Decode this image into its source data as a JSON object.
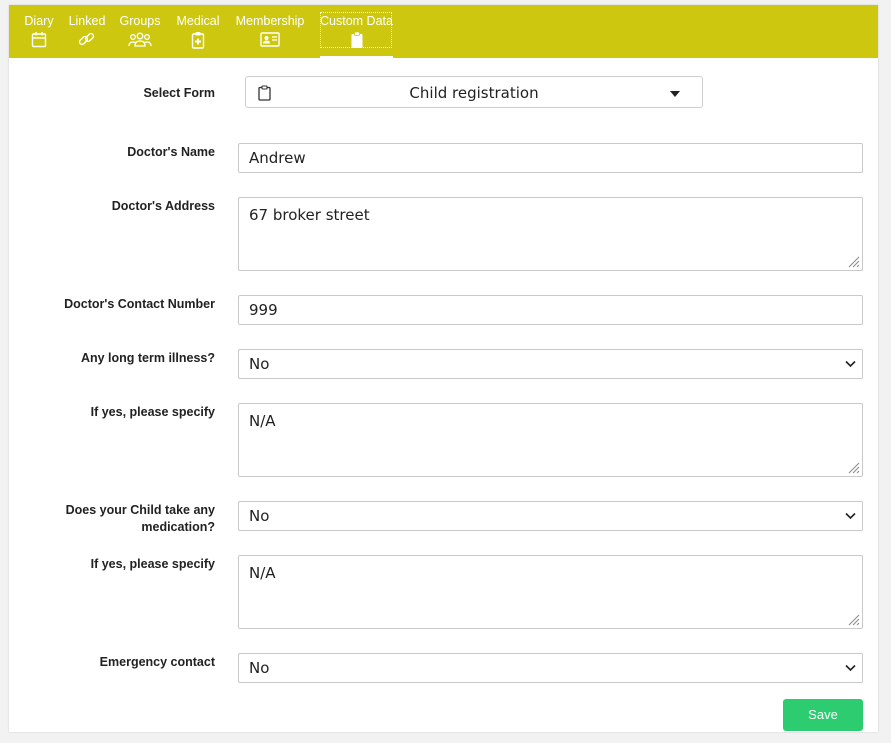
{
  "tabs": [
    {
      "label": "Diary",
      "icon": "calendar-icon"
    },
    {
      "label": "Linked",
      "icon": "link-icon"
    },
    {
      "label": "Groups",
      "icon": "group-icon"
    },
    {
      "label": "Medical",
      "icon": "medical-clipboard-icon"
    },
    {
      "label": "Membership",
      "icon": "id-card-icon"
    },
    {
      "label": "Custom Data",
      "icon": "clipboard-icon",
      "active": true
    }
  ],
  "form_select": {
    "label": "Select Form",
    "value": "Child registration"
  },
  "fields": {
    "doctor_name": {
      "label": "Doctor's Name",
      "value": "Andrew"
    },
    "doctor_address": {
      "label": "Doctor's Address",
      "value": "67 broker street"
    },
    "doctor_contact": {
      "label": "Doctor's Contact Number",
      "value": "999"
    },
    "long_term_illness": {
      "label": "Any long term illness?",
      "value": "No"
    },
    "illness_specify": {
      "label": "If yes, please specify",
      "value": "N/A"
    },
    "medication": {
      "label_line1": "Does your Child take any",
      "label_line2": "medication?",
      "value": "No"
    },
    "medication_specify": {
      "label": "If yes, please specify",
      "value": "N/A"
    },
    "emergency_contact": {
      "label": "Emergency contact",
      "value": "No"
    }
  },
  "save_label": "Save",
  "colors": {
    "tab_bar": "#cdc80f",
    "save_button": "#2ecc71"
  }
}
